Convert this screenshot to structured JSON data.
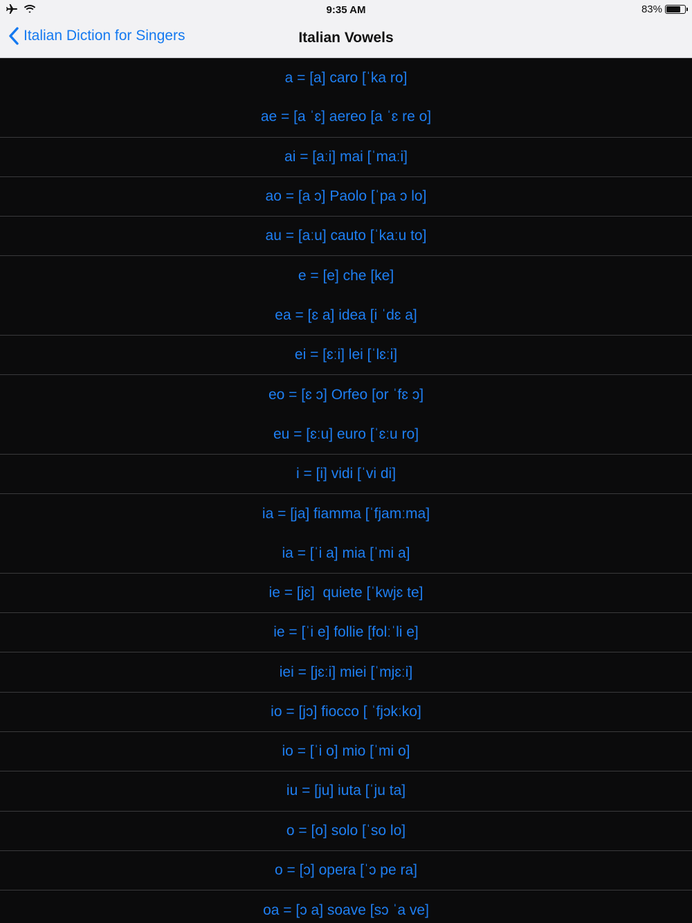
{
  "status": {
    "time": "9:35 AM",
    "battery": "83%",
    "battery_level": 0.83
  },
  "nav": {
    "back_label": "Italian Diction for Singers",
    "title": "Italian Vowels"
  },
  "rows": [
    {
      "text": "a = [a] caro [ˈka ro]",
      "separator_below": false
    },
    {
      "text": "ae = [a ˈɛ] aereo [a ˈɛ re o]",
      "separator_below": true
    },
    {
      "text": "ai = [aːi] mai [ˈmaːi]",
      "separator_below": true
    },
    {
      "text": "ao = [a ɔ] Paolo [ˈpa ɔ lo]",
      "separator_below": true
    },
    {
      "text": "au = [aːu] cauto [ˈkaːu to]",
      "separator_below": true
    },
    {
      "text": "e = [e] che [ke]",
      "separator_below": false
    },
    {
      "text": "ea = [ɛ a] idea [i ˈdɛ a]",
      "separator_below": true
    },
    {
      "text": "ei = [ɛːi] lei [ˈlɛːi]",
      "separator_below": true
    },
    {
      "text": "eo = [ɛ ɔ] Orfeo [or ˈfɛ ɔ]",
      "separator_below": false
    },
    {
      "text": "eu = [ɛːu] euro [ˈɛːu ro]",
      "separator_below": true
    },
    {
      "text": "i = [i] vidi [ˈvi di]",
      "separator_below": true
    },
    {
      "text": "ia = [ja] fiamma [ˈfjamːma]",
      "separator_below": false
    },
    {
      "text": "ia = [ˈi a] mia [ˈmi a]",
      "separator_below": true
    },
    {
      "text": "ie = [jɛ]  quiete [ˈkwjɛ te]",
      "separator_below": true
    },
    {
      "text": "ie = [ˈi e] follie [folːˈli e]",
      "separator_below": true
    },
    {
      "text": "iei = [jɛːi] miei [ˈmjɛːi]",
      "separator_below": true
    },
    {
      "text": "io = [jɔ] fiocco [ ˈfjɔkːko]",
      "separator_below": true
    },
    {
      "text": "io = [ˈi o] mio [ˈmi o]",
      "separator_below": true
    },
    {
      "text": "iu = [ju] iuta [ˈju ta]",
      "separator_below": true
    },
    {
      "text": "o = [o] solo [ˈso lo]",
      "separator_below": true
    },
    {
      "text": "o = [ɔ] opera [ˈɔ pe ra]",
      "separator_below": true
    },
    {
      "text": "oa = [ɔ a] soave [sɔ ˈa ve]",
      "separator_below": false
    }
  ],
  "icons": {
    "airplane": "airplane-icon",
    "wifi": "wifi-icon",
    "battery": "battery-icon",
    "back": "chevron-left-icon"
  },
  "colors": {
    "accent": "#1e7ff2",
    "background": "#0b0b0c",
    "bar": "#f2f2f4",
    "separator": "#3a3a3c"
  }
}
